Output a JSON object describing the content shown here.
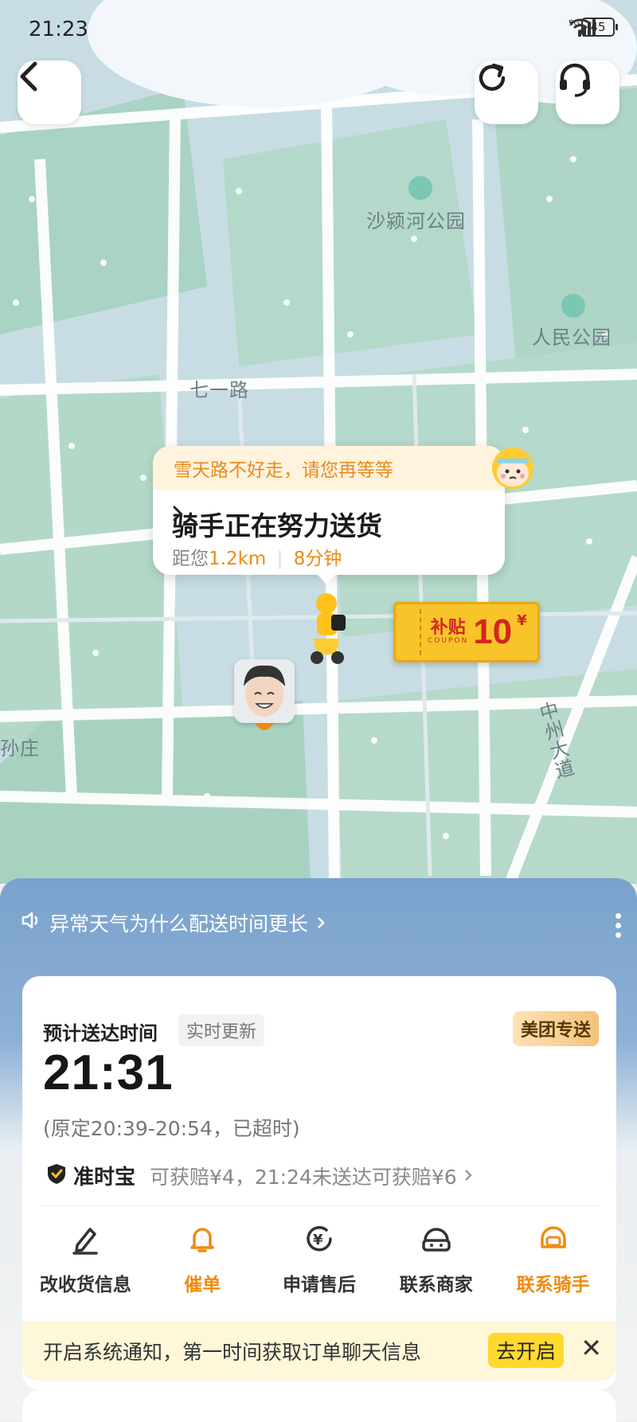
{
  "status_bar": {
    "time": "21:23",
    "battery": "45"
  },
  "nav": {
    "back_icon": "chevron-left-icon",
    "refresh_icon": "refresh-icon",
    "support_icon": "headset-icon"
  },
  "map_labels": {
    "park1": "沙颍河公园",
    "park2": "人民公园",
    "road1": "七一路",
    "road2": "中州大道",
    "village": "孙庄"
  },
  "rider_bubble": {
    "banner": "雪天路不好走，请您再等等",
    "title": "骑手正在努力送货",
    "distance_prefix": "距您",
    "distance": "1.2km",
    "eta": "8分钟"
  },
  "coupon": {
    "label": "补贴",
    "sub": "COUPON",
    "amount": "10",
    "currency": "¥"
  },
  "weather_notice": "异常天气为什么配送时间更长",
  "delivery": {
    "eta_label": "预计送达时间",
    "realtime_tag": "实时更新",
    "service_tag": "美团专送",
    "eta_time": "21:31",
    "original_window": "(原定20:39-20:54，已超时)",
    "ontime_title": "准时宝",
    "ontime_detail": "可获赔¥4，21:24未送达可获赔¥6"
  },
  "actions": [
    {
      "label": "改收货信息",
      "icon": "edit-icon"
    },
    {
      "label": "催单",
      "icon": "bell-icon"
    },
    {
      "label": "申请售后",
      "icon": "refund-icon"
    },
    {
      "label": "联系商家",
      "icon": "merchant-icon"
    },
    {
      "label": "联系骑手",
      "icon": "rider-helmet-icon"
    }
  ],
  "notification": {
    "text": "开启系统通知，第一时间获取订单聊天信息",
    "button": "去开启"
  },
  "colors": {
    "accent": "#f08a10",
    "sheet_blue": "#7aa2cc",
    "notify_yellow": "#ffd92f"
  }
}
